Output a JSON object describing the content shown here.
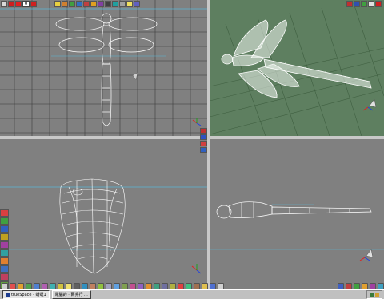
{
  "app": {
    "frame_value": "0",
    "accent": "#5ab6d6"
  },
  "viewports": {
    "top": {
      "icon": "top-view-icon",
      "background": "#808080"
    },
    "perspective": {
      "icon": "perspective-view-icon",
      "background": "#5e7f60"
    },
    "front": {
      "icon": "front-view-icon",
      "background": "#808080"
    },
    "side": {
      "icon": "side-view-icon",
      "background": "#808080"
    }
  },
  "top_toolbar": {
    "buttons": [
      {
        "name": "mode-icon",
        "color": "#d8d8d8"
      },
      {
        "name": "stop-icon",
        "color": "#cc2020"
      },
      {
        "name": "record-icon",
        "color": "#e02020"
      },
      {
        "name": "stop-icon",
        "color": "#d02020"
      }
    ],
    "tools": [
      {
        "name": "lamp-icon",
        "color": "#e8d040"
      },
      {
        "name": "box-icon",
        "color": "#d08030"
      },
      {
        "name": "move-icon",
        "color": "#40a040"
      },
      {
        "name": "scale-icon",
        "color": "#3070c0"
      },
      {
        "name": "rotate-icon",
        "color": "#c04040"
      },
      {
        "name": "render-icon",
        "color": "#e0a020"
      },
      {
        "name": "material-icon",
        "color": "#8040a0"
      },
      {
        "name": "camera-icon",
        "color": "#404040"
      },
      {
        "name": "path-icon",
        "color": "#20a0a0"
      },
      {
        "name": "grid-icon",
        "color": "#a0a0a0"
      },
      {
        "name": "light-icon",
        "color": "#f0e060"
      },
      {
        "name": "object-icon",
        "color": "#6060c0"
      }
    ],
    "right_tools": [
      {
        "name": "settings-icon",
        "color": "#c03030"
      },
      {
        "name": "window-icon",
        "color": "#3050b0"
      },
      {
        "name": "layout-icon",
        "color": "#40a040"
      },
      {
        "name": "help-icon",
        "color": "#e0e0e0"
      },
      {
        "name": "close-icon",
        "color": "#d02020"
      }
    ]
  },
  "left_tools": [
    {
      "name": "select-icon",
      "color": "#d84040"
    },
    {
      "name": "translate-icon",
      "color": "#40a040"
    },
    {
      "name": "rotate-icon",
      "color": "#3060c0"
    },
    {
      "name": "scale-icon",
      "color": "#c0a020"
    },
    {
      "name": "deform-icon",
      "color": "#a040a0"
    },
    {
      "name": "boolean-icon",
      "color": "#30a0a0"
    },
    {
      "name": "lathe-icon",
      "color": "#e08030"
    },
    {
      "name": "sweep-icon",
      "color": "#4070c0"
    },
    {
      "name": "skin-icon",
      "color": "#c04060"
    },
    {
      "name": "extrude-icon",
      "color": "#60a040"
    }
  ],
  "bottom_shelf": [
    {
      "name": "primitive-icon",
      "color": "#d0d0d0"
    },
    {
      "name": "sphere-icon",
      "color": "#e05050"
    },
    {
      "name": "cube-icon",
      "color": "#e0a030"
    },
    {
      "name": "cylinder-icon",
      "color": "#50a050"
    },
    {
      "name": "cone-icon",
      "color": "#5080d0"
    },
    {
      "name": "torus-icon",
      "color": "#b060b0"
    },
    {
      "name": "plane-icon",
      "color": "#40b0b0"
    },
    {
      "name": "text-icon",
      "color": "#d0c040"
    },
    {
      "name": "light-icon",
      "color": "#f0e070"
    },
    {
      "name": "camera-icon",
      "color": "#606060"
    },
    {
      "name": "path-icon",
      "color": "#3090c0"
    },
    {
      "name": "bone-icon",
      "color": "#c08060"
    },
    {
      "name": "particle-icon",
      "color": "#90c040"
    },
    {
      "name": "fog-icon",
      "color": "#a0a0c0"
    },
    {
      "name": "sky-icon",
      "color": "#60a0e0"
    },
    {
      "name": "ground-icon",
      "color": "#80a050"
    },
    {
      "name": "material-icon",
      "color": "#c05090"
    },
    {
      "name": "texture-icon",
      "color": "#9060c0"
    },
    {
      "name": "render-icon",
      "color": "#e09030"
    },
    {
      "name": "animation-icon",
      "color": "#40a080"
    },
    {
      "name": "script-icon",
      "color": "#7070a0"
    },
    {
      "name": "plugin-icon",
      "color": "#b0b040"
    },
    {
      "name": "color-icon",
      "color": "#e04040"
    },
    {
      "name": "palette-icon",
      "color": "#40c080"
    },
    {
      "name": "library-icon",
      "color": "#a07050"
    },
    {
      "name": "folder-icon",
      "color": "#e0c050"
    },
    {
      "name": "brush-icon",
      "color": "#5070d0"
    },
    {
      "name": "eye-icon",
      "color": "#d0d0d0"
    }
  ],
  "bottom_right_tools": [
    {
      "name": "playback-icon",
      "color": "#4060c0"
    },
    {
      "name": "keyframe-icon",
      "color": "#c04040"
    },
    {
      "name": "timeline-icon",
      "color": "#40a040"
    },
    {
      "name": "render-preview-icon",
      "color": "#e0a030"
    },
    {
      "name": "settings-icon",
      "color": "#a040a0"
    },
    {
      "name": "info-icon",
      "color": "#40a0c0"
    }
  ],
  "center_tools": [
    {
      "name": "view-toggle-icon",
      "color": "#c03030"
    },
    {
      "name": "zoom-icon",
      "color": "#3050c0"
    },
    {
      "name": "pan-icon",
      "color": "#d04040"
    },
    {
      "name": "home-view-icon",
      "color": "#3060c0"
    }
  ],
  "taskbar": {
    "start_label": "trueSpace - 蜻蜓1",
    "task_label": "電腦的 · 兩秀行 ...",
    "tray_icons": [
      "network-icon",
      "volume-icon"
    ]
  }
}
